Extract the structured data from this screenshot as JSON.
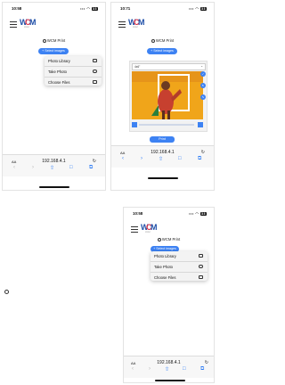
{
  "screens": [
    {
      "status_time": "10:58",
      "status_icons": "••• ◠",
      "battery": "33",
      "logo": {
        "w": "W",
        "c": "C",
        "m": "M",
        "sub": "PRINT"
      },
      "page_title": "WCM Print",
      "select_button": "+ Select images",
      "menu_items": [
        {
          "label": "Photo Library",
          "icon": "photo-library-icon"
        },
        {
          "label": "Take Photo",
          "icon": "camera-icon"
        },
        {
          "label": "Choose Files",
          "icon": "folder-icon"
        }
      ],
      "address": {
        "aa": "AA",
        "url": "192.168.4.1",
        "reload": "↻"
      },
      "nav": {
        "back": "‹",
        "forward": "›",
        "share": "⇧",
        "bookmarks": "□",
        "tabs": "⧉"
      }
    },
    {
      "status_time": "10:71",
      "status_icons": "••• ◠",
      "battery": "33",
      "logo": {
        "w": "W",
        "c": "C",
        "m": "M",
        "sub": "PRINT"
      },
      "page_title": "WCM Print",
      "select_button": "+ Select images",
      "size_option": "4x6\"",
      "print_button": "Print",
      "address": {
        "aa": "AA",
        "url": "192.168.4.1",
        "reload": "↻"
      },
      "nav": {
        "back": "‹",
        "forward": "›",
        "share": "⇧",
        "bookmarks": "□",
        "tabs": "⧉"
      }
    },
    {
      "status_time": "10:58",
      "status_icons": "••• ◠",
      "battery": "33",
      "logo": {
        "w": "W",
        "c": "C",
        "m": "M",
        "sub": "PRINT"
      },
      "page_title": "WCM Print",
      "select_button": "+ Select images",
      "menu_items": [
        {
          "label": "Photo Library",
          "icon": "photo-library-icon"
        },
        {
          "label": "Take Photo",
          "icon": "camera-icon"
        },
        {
          "label": "Choose Files",
          "icon": "folder-icon"
        }
      ],
      "address": {
        "aa": "AA",
        "url": "192.168.4.1",
        "reload": "↻"
      },
      "nav": {
        "back": "‹",
        "forward": "›",
        "share": "⇧",
        "bookmarks": "□",
        "tabs": "⧉"
      }
    }
  ],
  "colors": {
    "accent": "#3d82f3",
    "logo_blue": "#1e4fa8",
    "logo_red": "#d8334a",
    "photo_bg": "#f0a51a"
  }
}
